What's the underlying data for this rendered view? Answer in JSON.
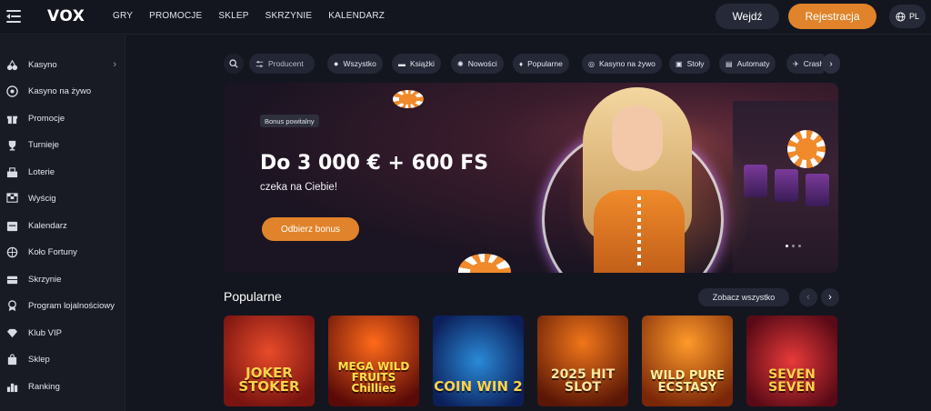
{
  "header": {
    "logo": "VOX",
    "nav": [
      "GRY",
      "PROMOCJE",
      "SKLEP",
      "SKRZYNIE",
      "KALENDARZ"
    ],
    "login_label": "Wejdź",
    "register_label": "Rejestracja",
    "language": "PL"
  },
  "sidebar": {
    "items": [
      {
        "label": "Kasyno",
        "icon": "cherries-icon"
      },
      {
        "label": "Kasyno na żywo",
        "icon": "roulette-icon"
      },
      {
        "label": "Promocje",
        "icon": "gift-icon"
      },
      {
        "label": "Turnieje",
        "icon": "trophy-icon"
      },
      {
        "label": "Loterie",
        "icon": "lottery-icon"
      },
      {
        "label": "Wyścig",
        "icon": "race-flag-icon"
      },
      {
        "label": "Kalendarz",
        "icon": "calendar-icon"
      },
      {
        "label": "Koło Fortuny",
        "icon": "wheel-icon"
      },
      {
        "label": "Skrzynie",
        "icon": "chest-icon"
      },
      {
        "label": "Program lojalnościowy",
        "icon": "loyalty-icon"
      },
      {
        "label": "Klub VIP",
        "icon": "diamond-icon"
      },
      {
        "label": "Sklep",
        "icon": "shop-bag-icon"
      },
      {
        "label": "Ranking",
        "icon": "ranking-icon"
      }
    ]
  },
  "filters": {
    "producer_label": "Producent",
    "chips": [
      "Wszystko",
      "Książki",
      "Nowości",
      "Popularne",
      "Kasyno na żywo",
      "Stoły",
      "Automaty",
      "Crash"
    ]
  },
  "banner": {
    "badge": "Bonus powitalny",
    "headline": "Do 3 000 € + 600 FS",
    "subtitle": "czeka na Ciebie!",
    "cta": "Odbierz bonus",
    "slides": 3,
    "active_slide": 1
  },
  "popular": {
    "title": "Popularne",
    "see_all": "Zobacz wszystko",
    "games": [
      {
        "name": "JOKER STOKER"
      },
      {
        "name": "MEGA WILD FRUITS Chillies"
      },
      {
        "name": "COIN WIN 2"
      },
      {
        "name": "2025 HIT SLOT"
      },
      {
        "name": "WILD PURE ECSTASY"
      },
      {
        "name": "SEVEN SEVEN"
      }
    ]
  },
  "colors": {
    "accent": "#e0832a",
    "background": "#14161f",
    "sidebar": "#181a24",
    "chip": "#242837"
  }
}
